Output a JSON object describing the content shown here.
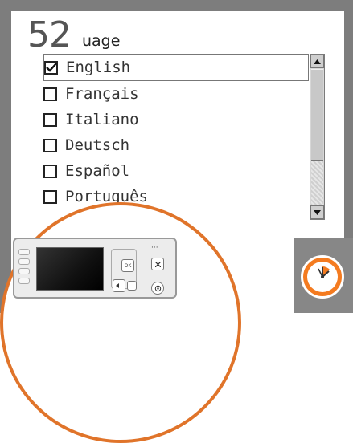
{
  "step_number": "52",
  "dialog": {
    "title_visible": "uage"
  },
  "languages": [
    {
      "label": "English",
      "checked": true
    },
    {
      "label": "Français",
      "checked": false
    },
    {
      "label": "Italiano",
      "checked": false
    },
    {
      "label": "Deutsch",
      "checked": false
    },
    {
      "label": "Español",
      "checked": false
    },
    {
      "label": "Português",
      "checked": false
    }
  ],
  "panel": {
    "ok_label": "OK"
  },
  "colors": {
    "accent": "#e0742a",
    "frame": "#7d7d7d",
    "clock": "#f47b20"
  },
  "icons": {
    "scroll_up": "arrow-up-icon",
    "scroll_down": "arrow-down-icon",
    "clock": "clock-icon",
    "check": "check-icon"
  }
}
